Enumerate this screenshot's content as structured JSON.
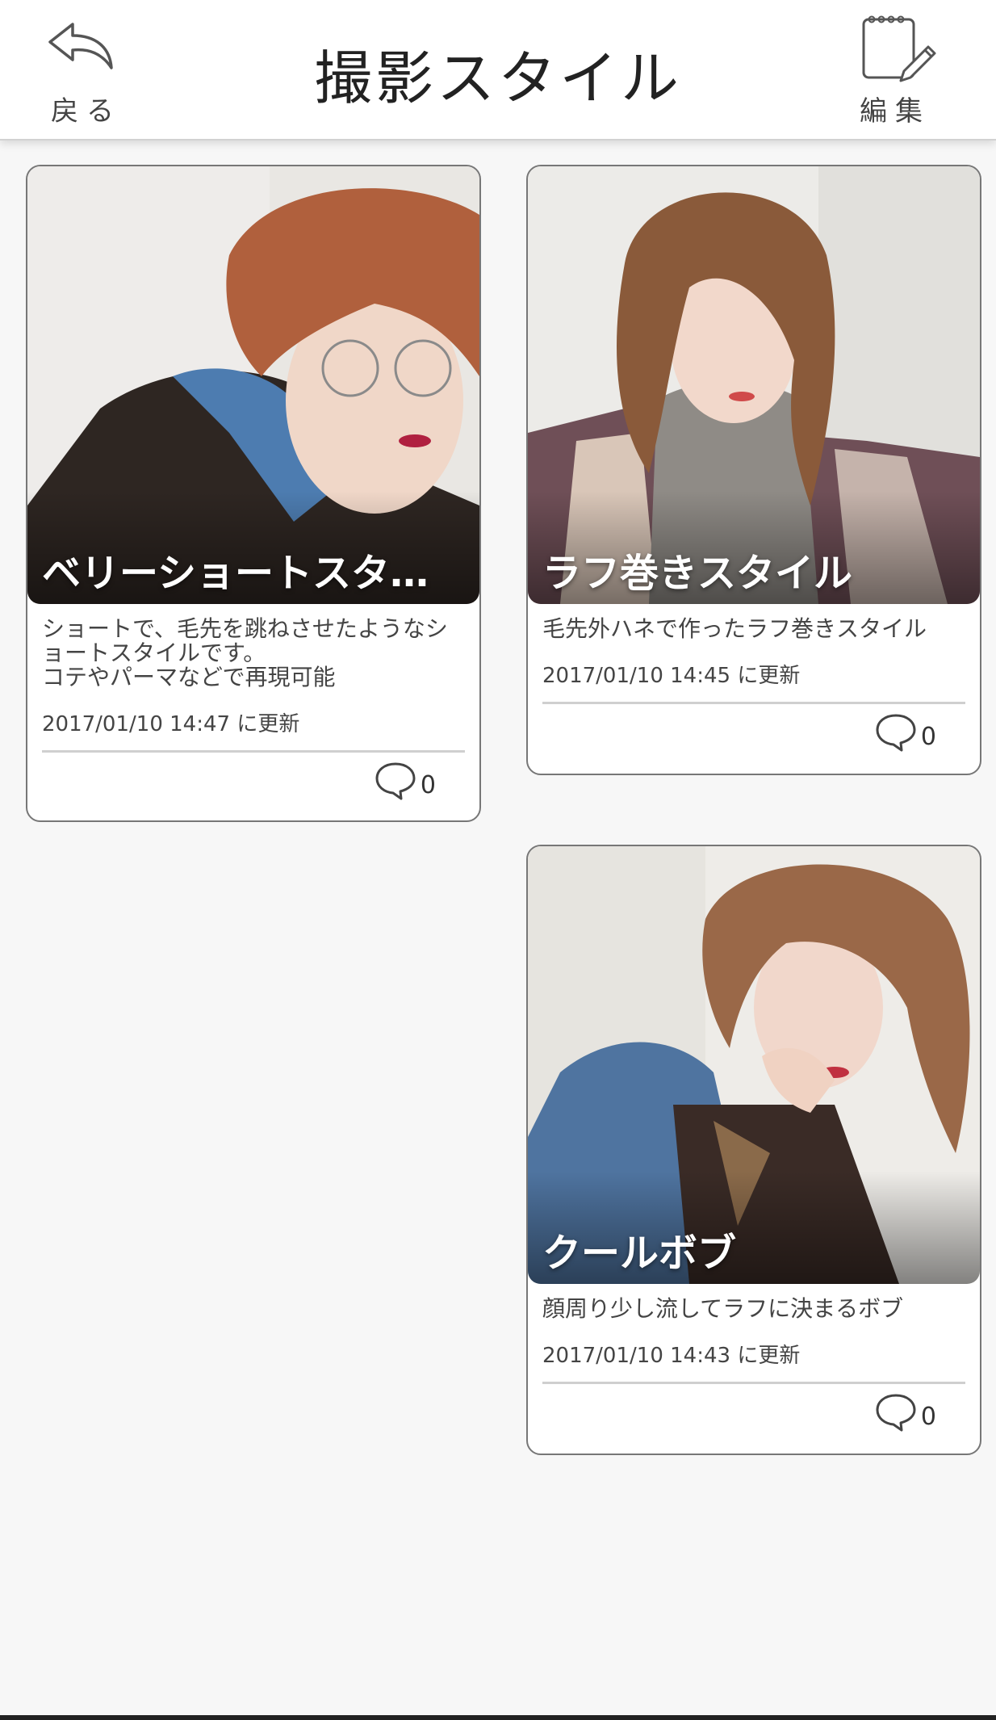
{
  "header": {
    "back_label": "戻る",
    "title": "撮影スタイル",
    "edit_label": "編集",
    "back_icon": "undo-arrow-icon",
    "edit_icon": "notepad-pencil-icon"
  },
  "cards": [
    {
      "title": "ベリーショートスタ…",
      "description": "ショートで、毛先を跳ねさせたようなショートスタイルです。\nコテやパーマなどで再現可能",
      "date": "2017/01/10 14:47 に更新",
      "comment_count": "0"
    },
    {
      "title": "ラフ巻きスタイル",
      "description": "毛先外ハネで作ったラフ巻きスタイル",
      "date": "2017/01/10 14:45 に更新",
      "comment_count": "0"
    },
    {
      "title": "クールボブ",
      "description": "顔周り少し流してラフに決まるボブ",
      "date": "2017/01/10 14:43 に更新",
      "comment_count": "0"
    }
  ],
  "colors": {
    "background": "#f7f7f7",
    "card_border": "#777777",
    "header_bg": "#ffffff",
    "title_text": "#222222"
  }
}
